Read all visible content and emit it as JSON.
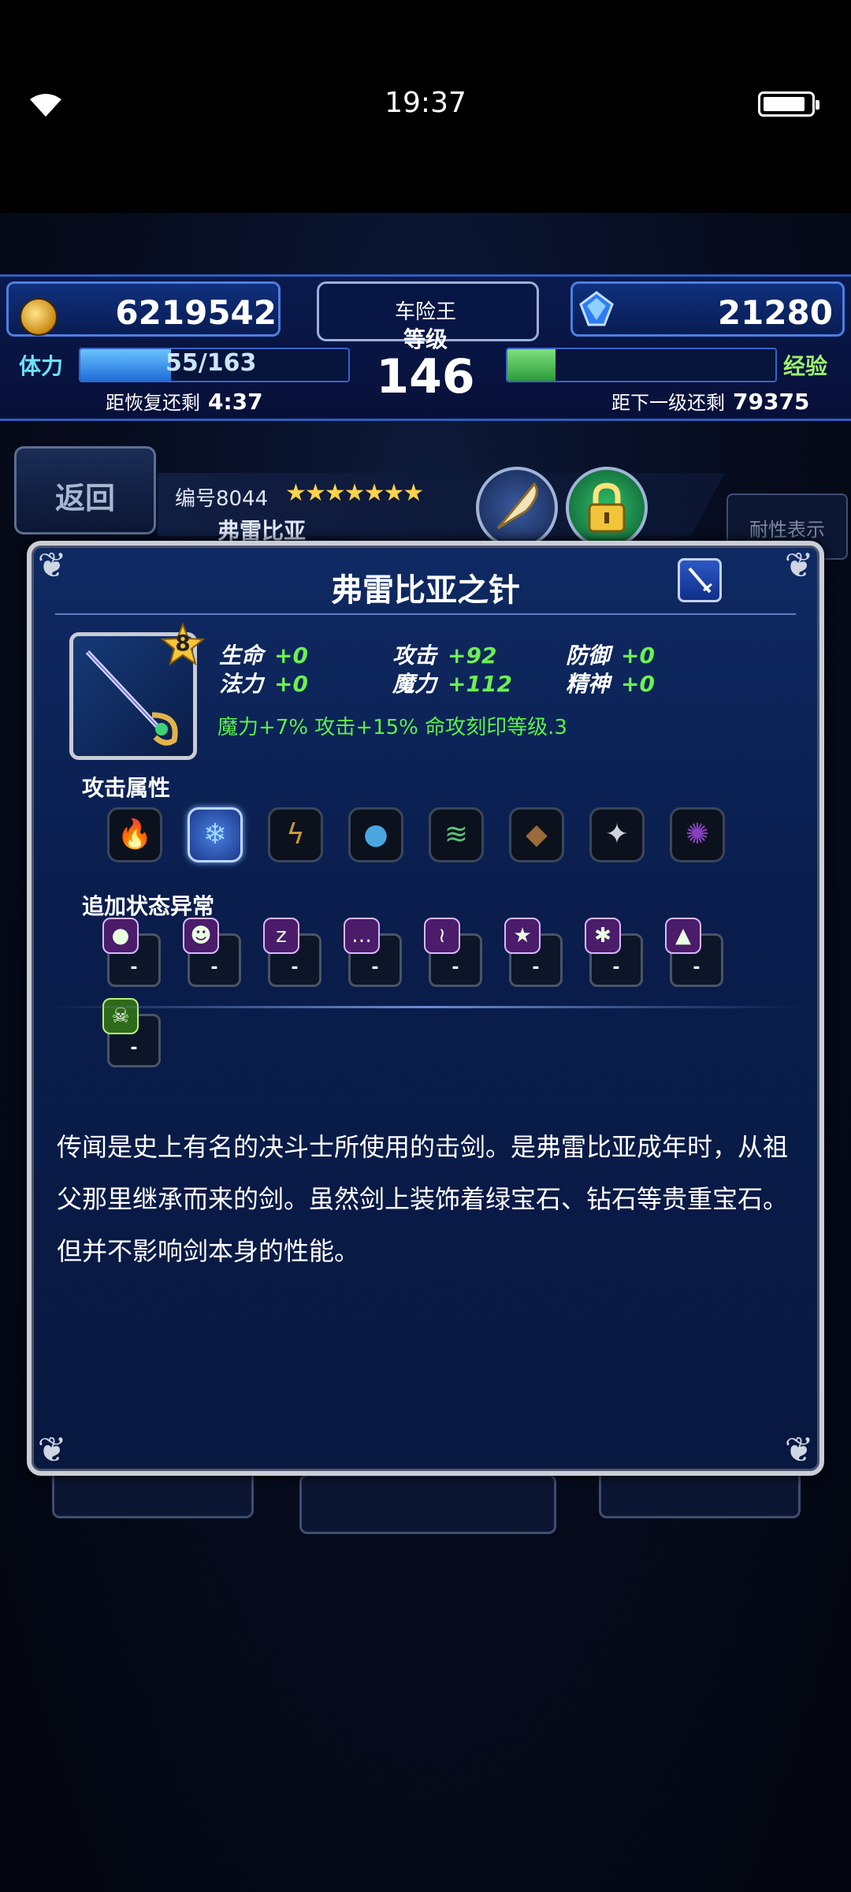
{
  "status_bar": {
    "time": "19:37"
  },
  "header": {
    "gil": "6219542",
    "gems": "21280",
    "player_name": "车险王",
    "level_label": "等级",
    "level": "146",
    "stamina_label": "体力",
    "stamina_text": "55/163",
    "stamina_fraction": 0.337,
    "recover_label": "距恢复还剩",
    "recover_time": "4:37",
    "exp_label": "经验",
    "exp_fraction": 0.18,
    "next_level_label": "距下一级还剩",
    "next_level_exp": "79375"
  },
  "background_page": {
    "back_label": "返回",
    "serial": "编号8044",
    "stars": "★★★★★★★",
    "unit_name": "弗雷比亚",
    "side_button_label": "耐性表示"
  },
  "item": {
    "title": "弗雷比亚之针",
    "rarity": "8",
    "stats": [
      {
        "key": "生命",
        "value": "+0"
      },
      {
        "key": "攻击",
        "value": "+92"
      },
      {
        "key": "防御",
        "value": "+0"
      },
      {
        "key": "法力",
        "value": "+0"
      },
      {
        "key": "魔力",
        "value": "+112"
      },
      {
        "key": "精神",
        "value": "+0"
      }
    ],
    "effect": "魔力+7% 攻击+15% 命攻刻印等级.3",
    "element_section_label": "攻击属性",
    "elements": [
      {
        "icon": "fire-icon",
        "color": "#e2552a",
        "active": false
      },
      {
        "icon": "ice-icon",
        "color": "#9fd7ff",
        "active": true
      },
      {
        "icon": "lightning-icon",
        "color": "#c99a3a",
        "active": false
      },
      {
        "icon": "water-icon",
        "color": "#4aa6e0",
        "active": false
      },
      {
        "icon": "wind-icon",
        "color": "#5ec07a",
        "active": false
      },
      {
        "icon": "earth-icon",
        "color": "#9a6a3a",
        "active": false
      },
      {
        "icon": "light-icon",
        "color": "#cfd3dc",
        "active": false
      },
      {
        "icon": "dark-icon",
        "color": "#8a3fc4",
        "active": false
      }
    ],
    "ailment_section_label": "追加状态异常",
    "ailments": [
      {
        "icon": "poison-icon",
        "value": "-"
      },
      {
        "icon": "blind-icon",
        "value": "-"
      },
      {
        "icon": "sleep-icon",
        "value": "-"
      },
      {
        "icon": "silence-icon",
        "value": "-"
      },
      {
        "icon": "paralyze-icon",
        "value": "-"
      },
      {
        "icon": "confuse-icon",
        "value": "-"
      },
      {
        "icon": "disease-icon",
        "value": "-"
      },
      {
        "icon": "petrify-icon",
        "value": "-"
      },
      {
        "icon": "death-icon",
        "value": "-"
      }
    ],
    "description": "传闻是史上有名的决斗士所使用的击剑。是弗雷比亚成年时，从祖父那里继承而来的剑。虽然剑上装饰着绿宝石、钻石等贵重宝石。但并不影响剑本身的性能。"
  }
}
